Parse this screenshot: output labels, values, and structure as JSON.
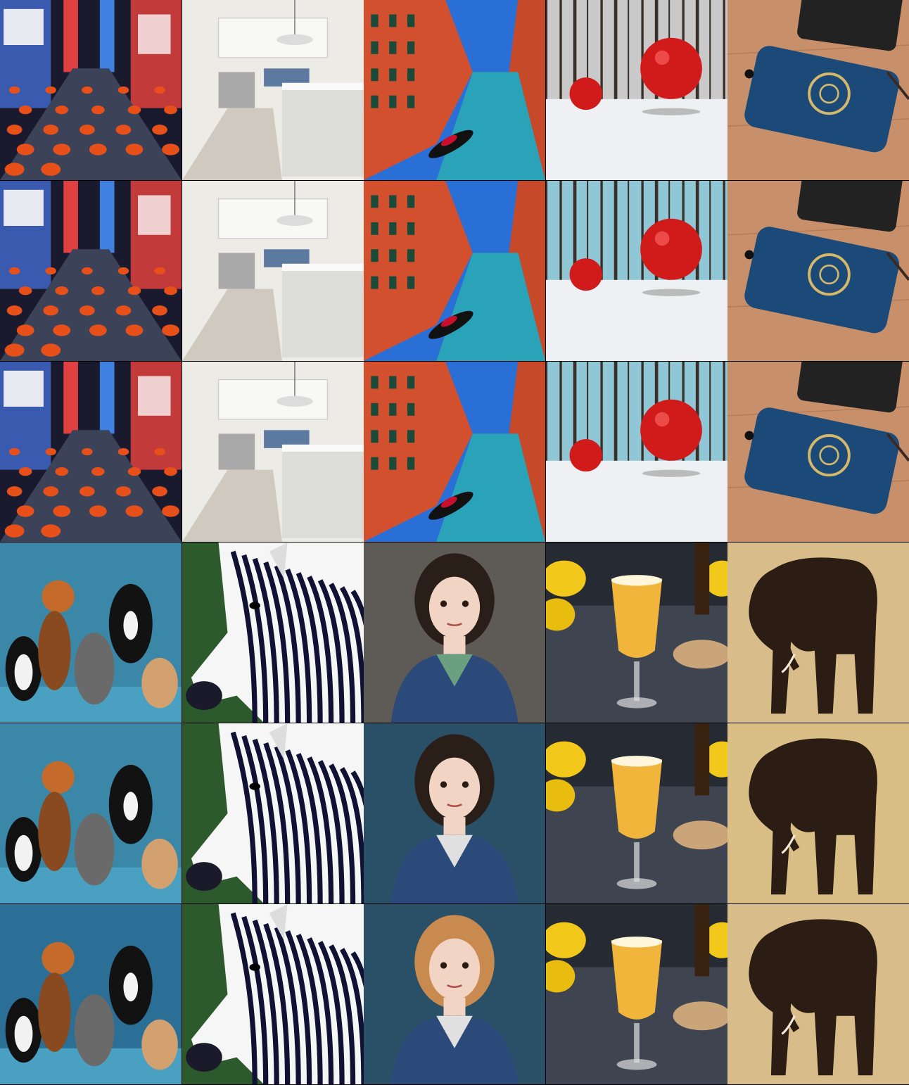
{
  "rows": [
    {
      "variant": "reference",
      "subjects": [
        "times-square-traffic",
        "white-kitchen",
        "venice-canal",
        "red-balls-snow-forest",
        "blue-phone-case"
      ]
    },
    {
      "variant": "method-b",
      "subjects": [
        "times-square-traffic",
        "white-kitchen",
        "venice-canal",
        "red-balls-snow-forest",
        "blue-phone-case"
      ]
    },
    {
      "variant": "method-c",
      "subjects": [
        "times-square-traffic",
        "white-kitchen",
        "venice-canal",
        "red-balls-snow-forest",
        "blue-phone-case"
      ]
    },
    {
      "variant": "reference",
      "subjects": [
        "cats-basketball",
        "zebra-portrait",
        "girl-portrait",
        "beer-glass-lemons",
        "elephant-silhouette"
      ]
    },
    {
      "variant": "method-b",
      "subjects": [
        "cats-basketball",
        "zebra-portrait",
        "girl-portrait",
        "beer-glass-lemons",
        "elephant-silhouette"
      ]
    },
    {
      "variant": "method-c",
      "subjects": [
        "cats-basketball",
        "zebra-portrait",
        "girl-portrait",
        "beer-glass-lemons",
        "elephant-silhouette"
      ]
    }
  ],
  "colors": {
    "background": "#000000",
    "taxi": "#e8501a",
    "canal": "#2aa3b8",
    "building": "#d2502e",
    "redBall": "#d11a1a",
    "phone": "#1c4a78",
    "wood": "#c8906a",
    "zebraStripe": "#111133",
    "elephant": "#2b1d14",
    "beer": "#f0b53a"
  }
}
